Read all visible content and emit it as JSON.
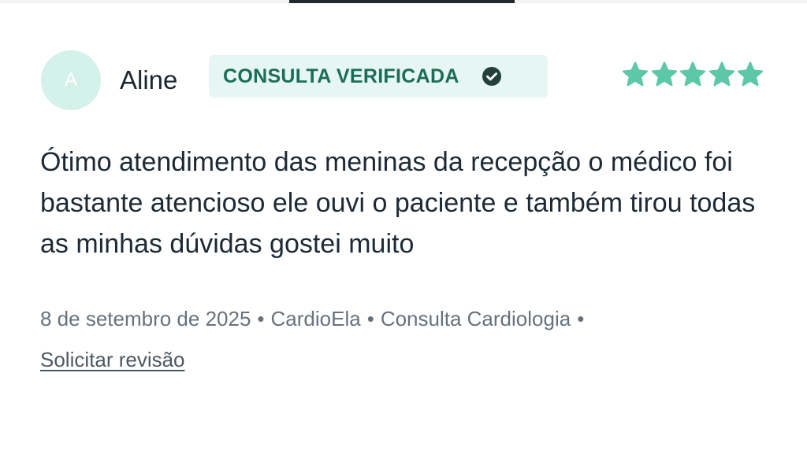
{
  "review": {
    "avatar_initial": "A",
    "author": "Aline",
    "badge_label": "CONSULTA VERIFICADA",
    "rating": 5,
    "rating_max": 5,
    "text": "Ótimo atendimento das meninas da recepção o médico foi bastante atencioso ele ouvi o paciente e também tirou todas as minhas dúvidas gostei muito",
    "date": "8 de setembro de 2025",
    "separator": "•",
    "clinic": "CardioEla",
    "service": "Consulta Cardiologia",
    "revision_link": "Solicitar revisão"
  },
  "colors": {
    "accent": "#5cc8a8",
    "badge_bg": "#e6f6f2",
    "badge_text": "#1c6c5a",
    "avatar_bg": "#d4f1ea"
  },
  "icons": {
    "check": "check-circle-icon",
    "star": "star-icon"
  }
}
